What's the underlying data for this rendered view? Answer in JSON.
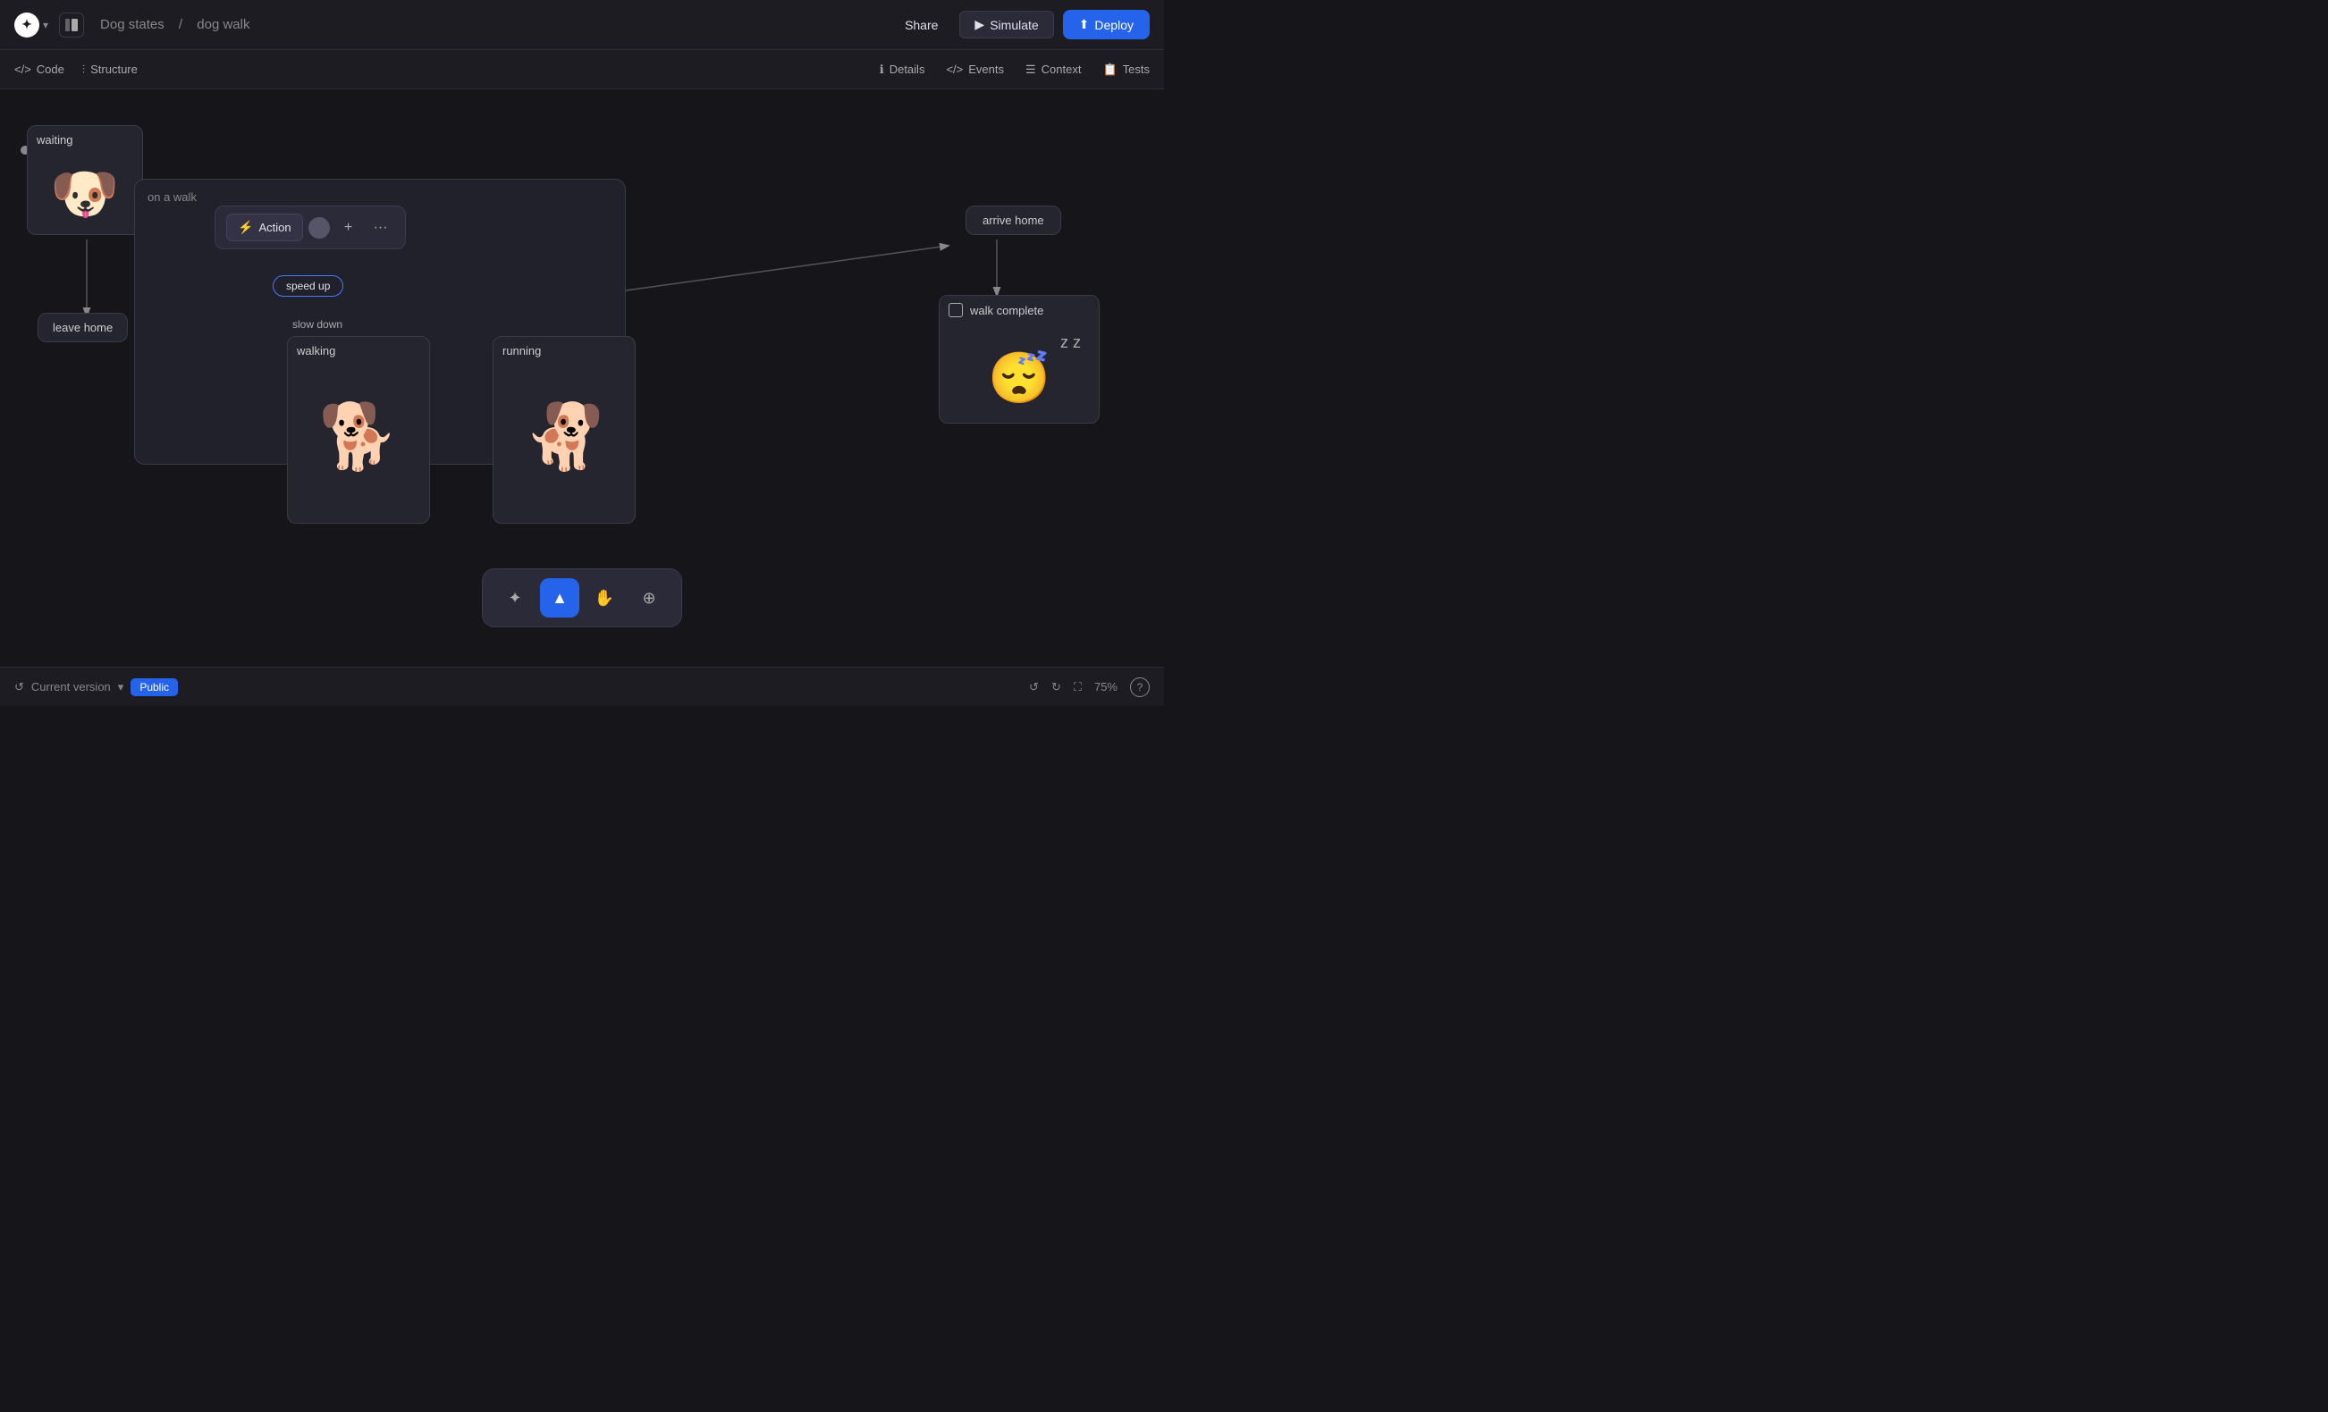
{
  "header": {
    "logo_text": "✦",
    "project_name": "Dog states",
    "separator": "/",
    "page_name": "dog walk",
    "share_label": "Share",
    "simulate_label": "Simulate",
    "deploy_label": "Deploy"
  },
  "toolbar": {
    "code_label": "Code",
    "structure_label": "Structure",
    "details_label": "Details",
    "events_label": "Events",
    "context_label": "Context",
    "tests_label": "Tests"
  },
  "canvas": {
    "states": {
      "waiting": {
        "label": "waiting"
      },
      "on_a_walk": {
        "label": "on a walk"
      },
      "walking": {
        "label": "walking"
      },
      "running": {
        "label": "running"
      },
      "arrive_home": {
        "label": "arrive home"
      },
      "walk_complete": {
        "label": "walk complete"
      },
      "leave_home": {
        "label": "leave home"
      }
    },
    "transitions": {
      "speed_up": "speed up",
      "slow_down": "slow down"
    },
    "action_toolbar": {
      "action_label": "Action",
      "plus_label": "+",
      "more_label": "···"
    }
  },
  "bottom_toolbar": {
    "sparkle_icon": "✦",
    "cursor_icon": "▲",
    "hand_icon": "✋",
    "plus_icon": "⊕"
  },
  "status_bar": {
    "version_label": "Current version",
    "badge_label": "Public",
    "zoom_label": "75%",
    "help_icon": "?"
  }
}
